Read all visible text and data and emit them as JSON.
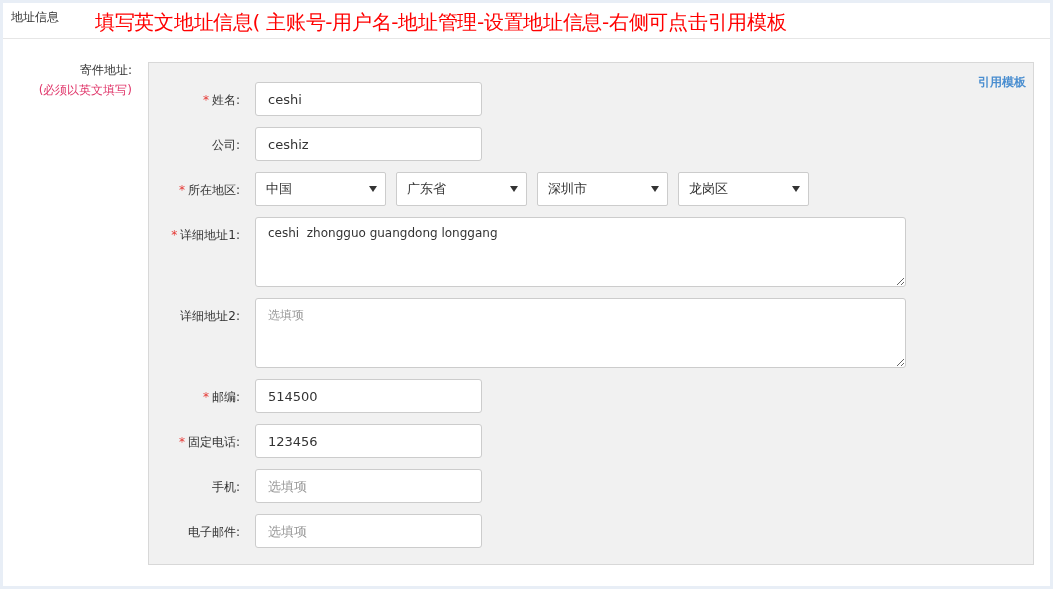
{
  "header": {
    "title": "地址信息",
    "annotation": "填写英文地址信息( 主账号-用户名-地址管理-设置地址信息-右侧可点击引用模板"
  },
  "section": {
    "label": "寄件地址:",
    "note": "(必须以英文填写)",
    "template_link": "引用模板"
  },
  "fields": [
    {
      "kind": "text",
      "required_mark": "*",
      "label": "姓名:",
      "value": "ceshi"
    },
    {
      "kind": "text",
      "label": "公司:",
      "value": "ceshiz"
    },
    {
      "kind": "selects",
      "required_mark": "*",
      "label": "所在地区:",
      "selects": [
        "中国",
        "广东省",
        "深圳市",
        "龙岗区"
      ]
    },
    {
      "kind": "textarea",
      "required_mark": "*",
      "label": "详细地址1:",
      "value": "ceshi  zhongguo guangdong longgang"
    },
    {
      "kind": "textarea",
      "label": "详细地址2:",
      "placeholder": "选填项"
    },
    {
      "kind": "text",
      "required_mark": "*",
      "label": "邮编:",
      "value": "514500"
    },
    {
      "kind": "text",
      "required_mark": "*",
      "label": "固定电话:",
      "value": "123456"
    },
    {
      "kind": "text",
      "label": "手机:",
      "placeholder": "选填项"
    },
    {
      "kind": "text",
      "label": "电子邮件:",
      "placeholder": "选填项"
    }
  ]
}
